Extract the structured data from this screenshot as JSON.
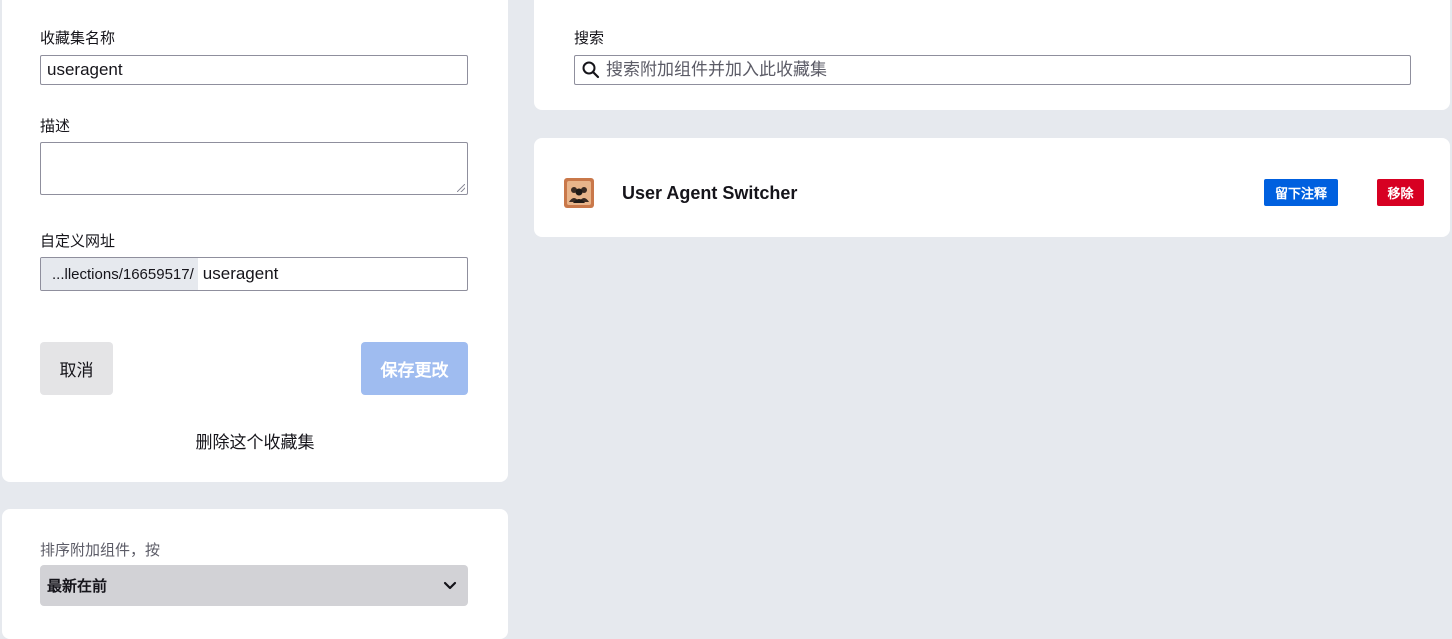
{
  "edit_form": {
    "name_label": "收藏集名称",
    "name_value": "useragent",
    "description_label": "描述",
    "description_value": "",
    "url_label": "自定义网址",
    "url_prefix": "...llections/16659517/",
    "url_slug": "useragent",
    "cancel_label": "取消",
    "save_label": "保存更改",
    "delete_label": "删除这个收藏集"
  },
  "sort": {
    "label": "排序附加组件，按",
    "selected": "最新在前",
    "icon": "chevron-down-icon"
  },
  "search": {
    "label": "搜索",
    "placeholder": "搜索附加组件并加入此收藏集",
    "icon": "search-icon"
  },
  "addons": [
    {
      "name": "User Agent Switcher",
      "icon": "user-agent-switcher-icon",
      "note_label": "留下注释",
      "remove_label": "移除"
    }
  ],
  "colors": {
    "page_background": "#e6e9ee",
    "card_background": "#ffffff",
    "save_button_disabled": "#9fbcf0",
    "note_button": "#0060df",
    "remove_button": "#d70022",
    "select_background": "#d2d2d6"
  }
}
